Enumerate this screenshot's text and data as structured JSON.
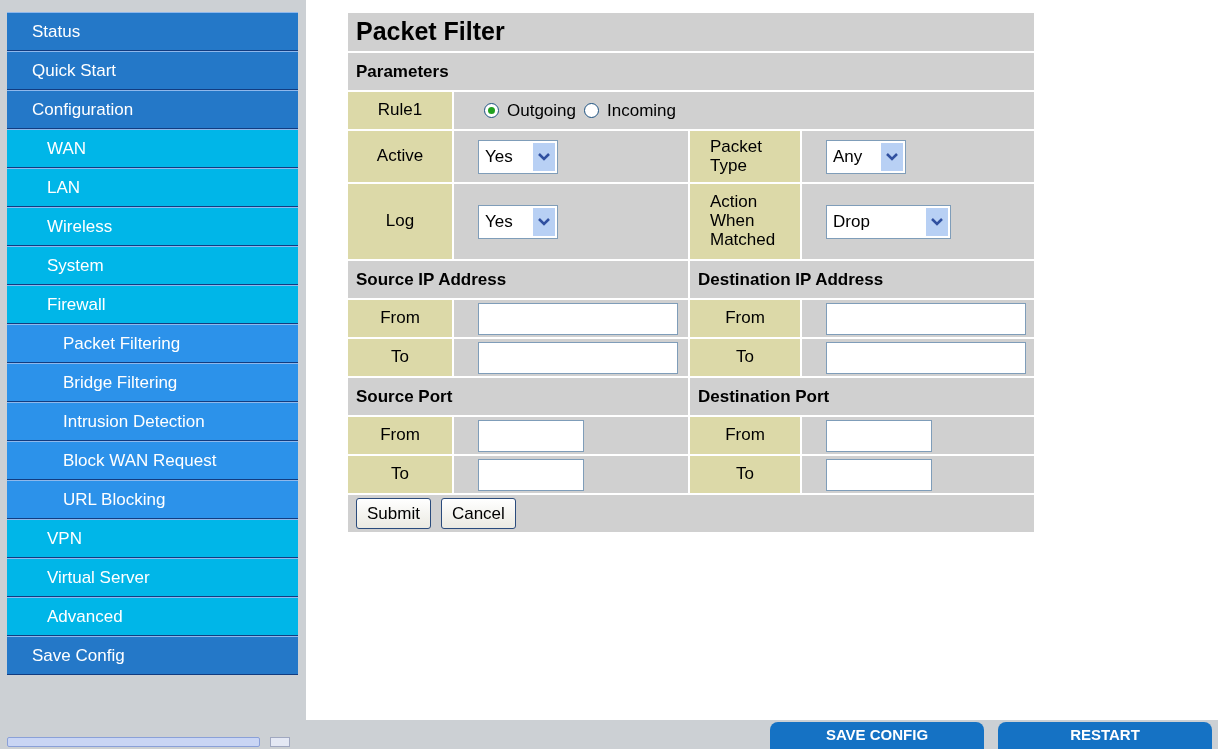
{
  "sidebar": {
    "items": [
      {
        "label": "Status"
      },
      {
        "label": "Quick Start"
      },
      {
        "label": "Configuration",
        "children": [
          {
            "label": "WAN"
          },
          {
            "label": "LAN"
          },
          {
            "label": "Wireless"
          },
          {
            "label": "System"
          },
          {
            "label": "Firewall",
            "children": [
              {
                "label": "Packet Filtering"
              },
              {
                "label": "Bridge Filtering"
              },
              {
                "label": "Intrusion Detection"
              },
              {
                "label": "Block WAN Request"
              },
              {
                "label": "URL Blocking"
              }
            ]
          },
          {
            "label": "VPN"
          },
          {
            "label": "Virtual Server"
          },
          {
            "label": "Advanced"
          }
        ]
      },
      {
        "label": "Save Config"
      }
    ]
  },
  "form": {
    "title": "Packet Filter",
    "section": "Parameters",
    "rule": {
      "label": "Rule1",
      "options": [
        {
          "label": "Outgoing",
          "selected": true
        },
        {
          "label": "Incoming",
          "selected": false
        }
      ]
    },
    "settings": [
      {
        "left": {
          "label": "Active",
          "value": "Yes"
        },
        "right": {
          "label": "Packet Type",
          "value": "Any"
        }
      },
      {
        "left": {
          "label": "Log",
          "value": "Yes"
        },
        "right": {
          "label": "Action When Matched",
          "value": "Drop"
        }
      }
    ],
    "groups": [
      {
        "kind": "ip",
        "left": {
          "title": "Source IP Address",
          "rows": [
            "From",
            "To"
          ]
        },
        "right": {
          "title": "Destination IP Address",
          "rows": [
            "From",
            "To"
          ]
        }
      },
      {
        "kind": "port",
        "left": {
          "title": "Source Port",
          "rows": [
            "From",
            "To"
          ]
        },
        "right": {
          "title": "Destination Port",
          "rows": [
            "From",
            "To"
          ]
        }
      }
    ],
    "buttons": [
      "Submit",
      "Cancel"
    ]
  },
  "footer": {
    "buttons": [
      "SAVE CONFIG",
      "RESTART"
    ]
  }
}
